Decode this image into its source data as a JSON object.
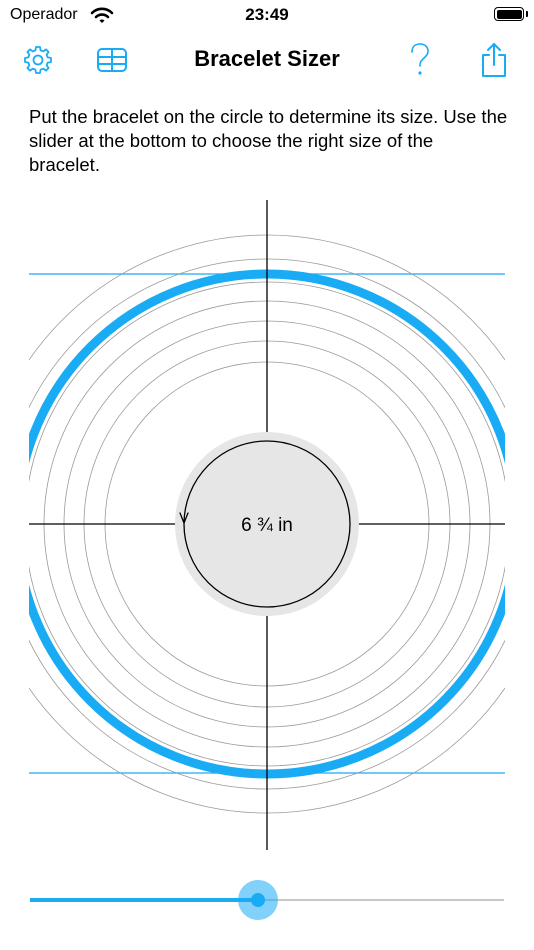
{
  "status_bar": {
    "carrier": "Operador",
    "time": "23:49",
    "battery_level": 1.0
  },
  "nav": {
    "title": "Bracelet Sizer",
    "left_icons": [
      "gear-icon",
      "table-icon"
    ],
    "right_icons": [
      "question-mark-icon",
      "share-icon"
    ]
  },
  "instructions": "Put the bracelet on the circle to determine its size. Use the slider at the bottom to choose the right size of the bracelet.",
  "sizer": {
    "size_label": "6 ¾ in"
  },
  "slider": {
    "value": 0.48
  },
  "colors": {
    "accent": "#1aabf5",
    "inner_disc": "#e6e6e6",
    "guide_circles": "#9a9a9a"
  }
}
